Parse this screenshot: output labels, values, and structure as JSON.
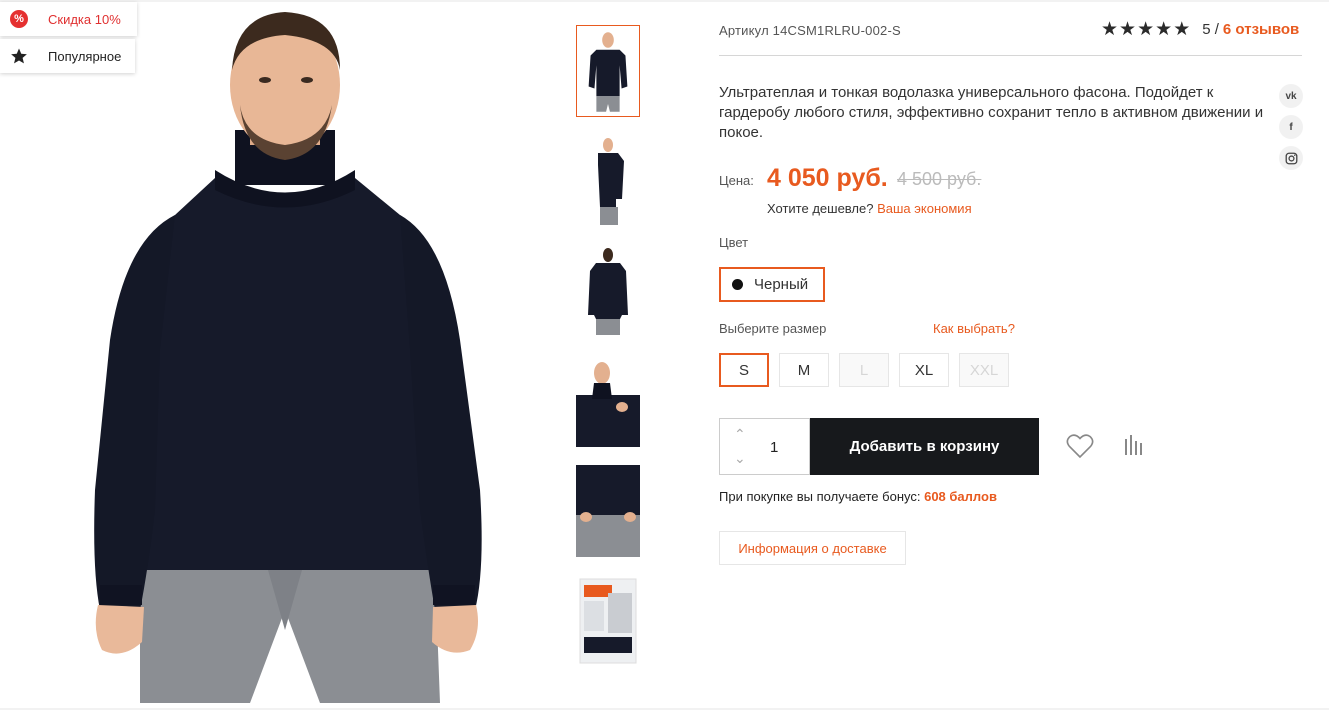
{
  "badges": {
    "sale_label": "Скидка 10%",
    "sale_icon": "percent-icon",
    "popular_label": "Популярное",
    "popular_icon": "star-icon"
  },
  "product": {
    "article": "Артикул 14CSM1RLRU-002-S",
    "rating": {
      "stars": 5,
      "score_text": "5 /",
      "reviews_text": "6 отзывов"
    },
    "description": "Ультратеплая и тонкая водолазка универсального фасона. Подойдет к гардеробу любого стиля, эффективно сохранит тепло в активном движении и покое.",
    "price_label": "Цена:",
    "price_new": "4 050 руб.",
    "price_old": "4 500 руб.",
    "cheaper_text": "Хотите дешевле?",
    "cheaper_link": "Ваша экономия",
    "color_label": "Цвет",
    "color_value": "Черный",
    "size_label": "Выберите размер",
    "size_help": "Как выбрать?",
    "sizes": [
      {
        "label": "S",
        "state": "selected"
      },
      {
        "label": "M",
        "state": "available"
      },
      {
        "label": "L",
        "state": "disabled"
      },
      {
        "label": "XL",
        "state": "available"
      },
      {
        "label": "XXL",
        "state": "disabled"
      }
    ],
    "quantity": "1",
    "add_to_cart": "Добавить в корзину",
    "bonus_text": "При покупке вы получаете бонус:",
    "bonus_value": "608 баллов",
    "delivery_info": "Информация о доставке"
  },
  "share": [
    {
      "label": "vk",
      "icon": "vk-icon"
    },
    {
      "label": "f",
      "icon": "facebook-icon"
    },
    {
      "label": "ig",
      "icon": "instagram-icon"
    }
  ],
  "colors": {
    "accent": "#e85a1f",
    "dark": "#17191c",
    "sale": "#e53030"
  }
}
